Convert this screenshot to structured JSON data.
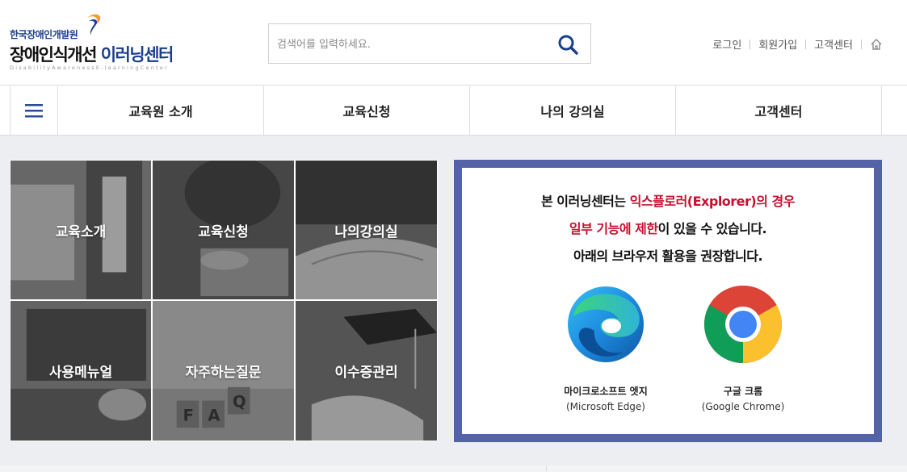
{
  "header": {
    "logo": {
      "org": "한국장애인개발원",
      "title_part1": "장애인식개선",
      "title_part2": "이러닝센터",
      "subtitle": "DisabilityAwarenessE-learningCenter"
    },
    "search": {
      "placeholder": "검색어를 입력하세요.",
      "value": ""
    },
    "util_links": {
      "login": "로그인",
      "signup": "회원가입",
      "support": "고객센터"
    }
  },
  "nav": {
    "items": [
      {
        "label": "교육원 소개"
      },
      {
        "label": "교육신청"
      },
      {
        "label": "나의 강의실"
      },
      {
        "label": "고객센터"
      }
    ]
  },
  "tiles": [
    {
      "label": "교육소개"
    },
    {
      "label": "교육신청"
    },
    {
      "label": "나의강의실"
    },
    {
      "label": "사용메뉴얼"
    },
    {
      "label": "자주하는질문"
    },
    {
      "label": "이수증관리"
    }
  ],
  "notice": {
    "line1_a": "본 이러닝센터는 ",
    "line1_red": "익스플로러(Explorer)의 경우",
    "line2_red": "일부 기능에 제한",
    "line2_b": "이 있을 수 있습니다.",
    "line3": "아래의 브라우저 활용을 권장합니다.",
    "browsers": [
      {
        "name": "마이크로소프트 엣지",
        "eng": "(Microsoft Edge)",
        "icon": "edge-icon"
      },
      {
        "name": "구글 크롬",
        "eng": "(Google Chrome)",
        "icon": "chrome-icon"
      }
    ]
  },
  "colors": {
    "brand_blue": "#1c3f8c",
    "notice_border": "#5462a8",
    "warning_red": "#c8102e",
    "main_bg": "#eceef1"
  }
}
